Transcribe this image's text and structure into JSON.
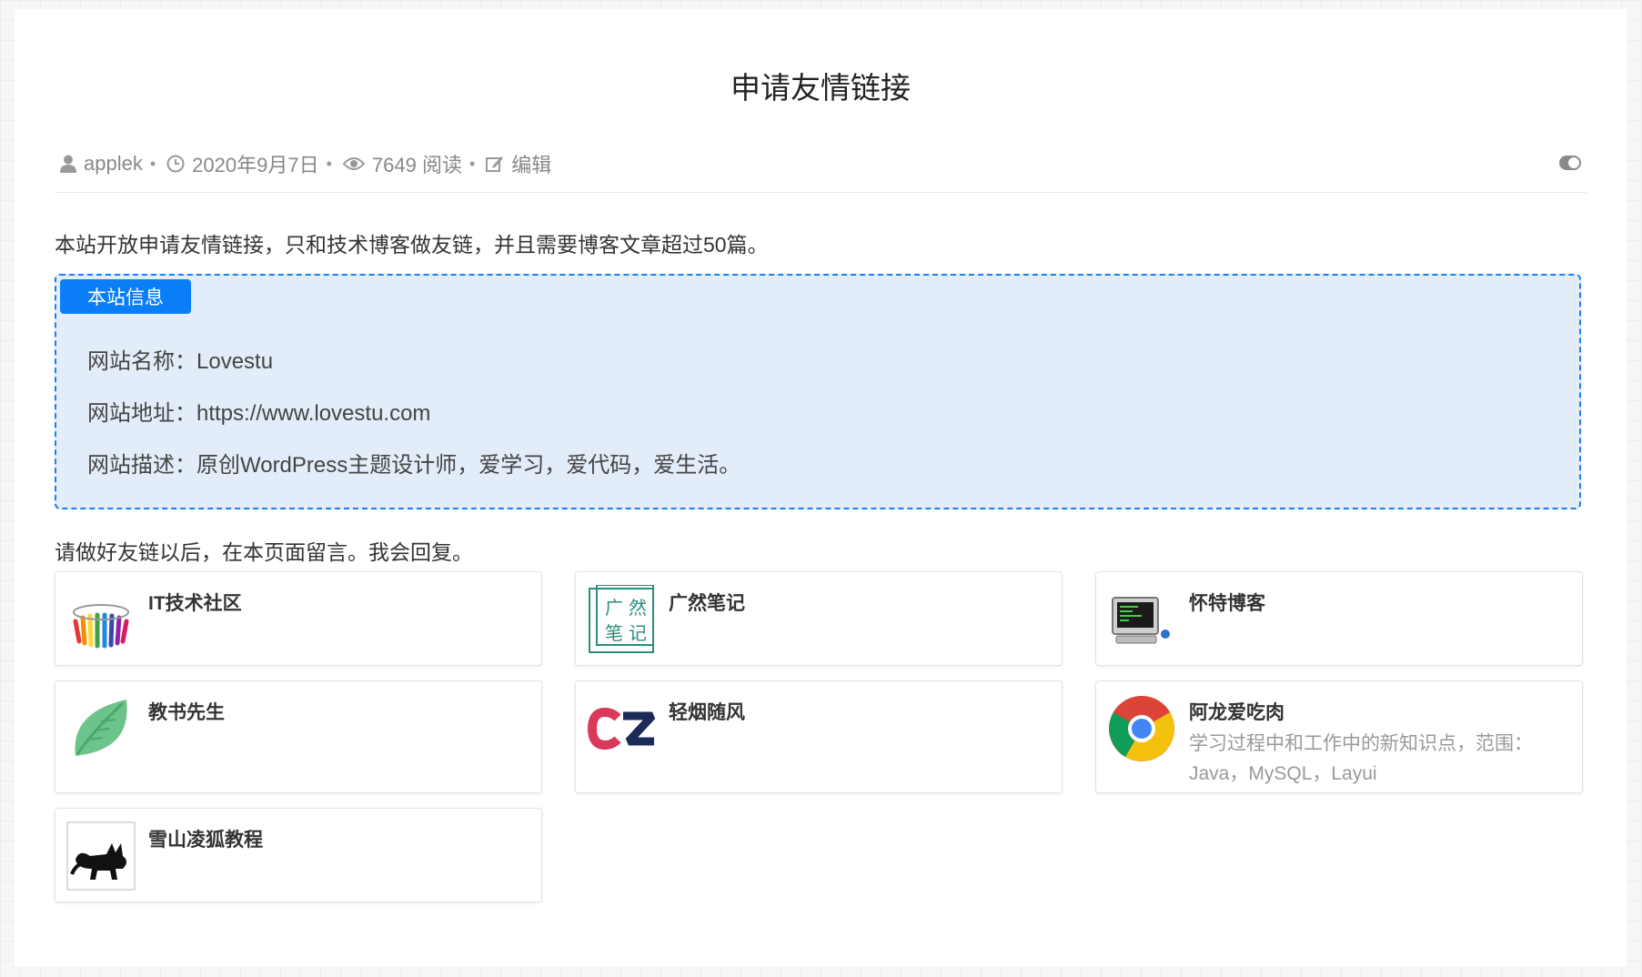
{
  "page": {
    "title": "申请友情链接"
  },
  "meta": {
    "author": "applek",
    "date": "2020年9月7日",
    "views": "7649 阅读",
    "edit_label": "编辑",
    "separator": "•",
    "icons": [
      "user-icon",
      "clock-icon",
      "eye-icon",
      "edit-icon",
      "toggle-icon"
    ]
  },
  "content": {
    "intro": "本站开放申请友情链接，只和技术博客做友链，并且需要博客文章超过50篇。",
    "info_box": {
      "badge": "本站信息",
      "name_line": "网站名称：Lovestu",
      "url_line": "网站地址：https://www.lovestu.com",
      "desc_line": "网站描述：原创WordPress主题设计师，爱学习，爱代码，爱生活。"
    },
    "outro": "请做好友链以后，在本页面留言。我会回复。"
  },
  "links": [
    {
      "name": "IT技术社区",
      "desc": "",
      "logo": "rainbow-people-logo"
    },
    {
      "name": "广然笔记",
      "desc": "",
      "logo": "guangran-notes-logo"
    },
    {
      "name": "怀特博客",
      "desc": "",
      "logo": "computer-monitor-logo"
    },
    {
      "name": "教书先生",
      "desc": "",
      "logo": "green-leaf-logo"
    },
    {
      "name": "轻烟随风",
      "desc": "",
      "logo": "cz-logo"
    },
    {
      "name": "阿龙爱吃肉",
      "desc": "学习过程中和工作中的新知识点，范围：Java，MySQL，Layui",
      "logo": "chrome-logo"
    },
    {
      "name": "雪山凌狐教程",
      "desc": "",
      "logo": "fox-logo"
    }
  ],
  "colors": {
    "accent": "#0a7ef7",
    "info_bg": "#e3edf9",
    "muted": "#888888"
  }
}
